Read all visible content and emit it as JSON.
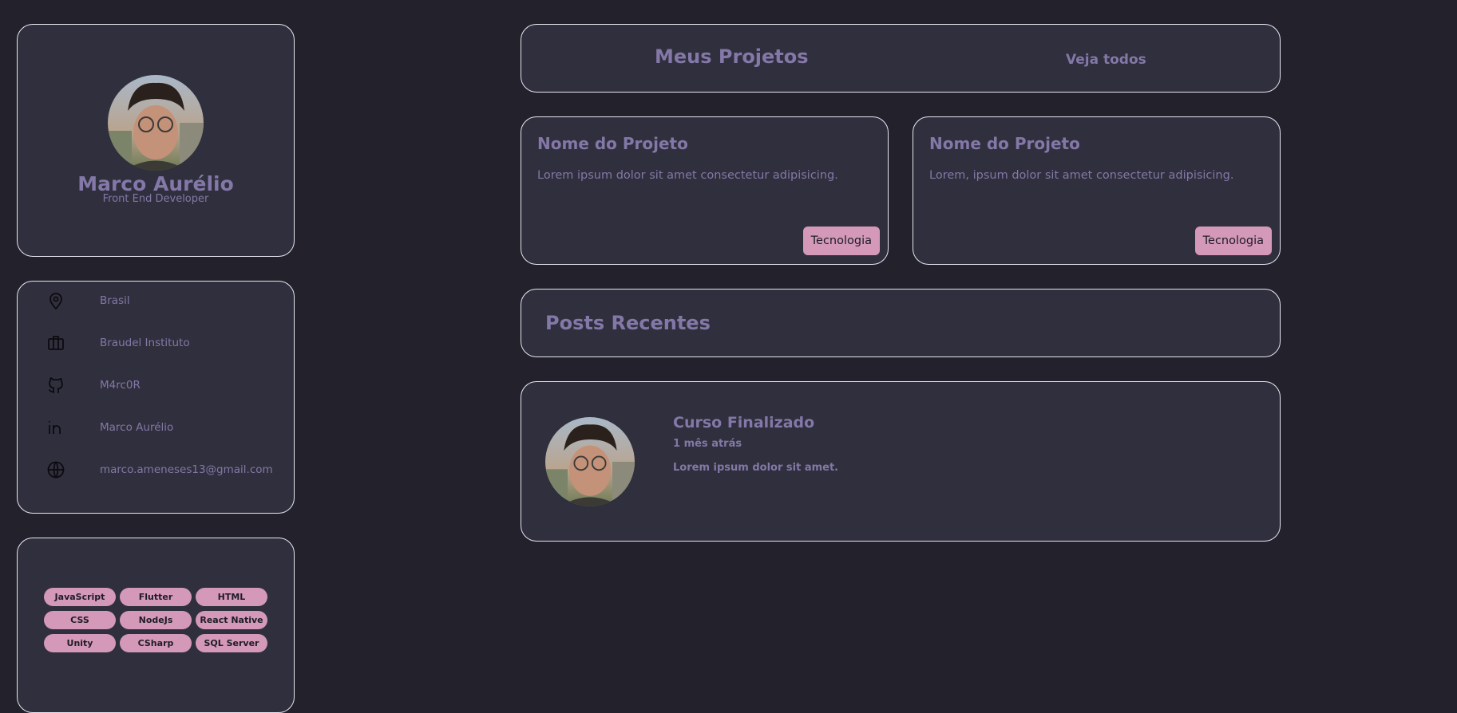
{
  "profile": {
    "name": "Marco Aurélio",
    "role": "Front End Developer"
  },
  "info": [
    {
      "icon": "location-pin-icon",
      "text": "Brasil"
    },
    {
      "icon": "briefcase-icon",
      "text": "Braudel Instituto"
    },
    {
      "icon": "github-icon",
      "text": "M4rc0R"
    },
    {
      "icon": "linkedin-icon",
      "text": "Marco Aurélio"
    },
    {
      "icon": "globe-icon",
      "text": "marco.ameneses13@gmail.com"
    }
  ],
  "skills": [
    "JavaScript",
    "Flutter",
    "HTML",
    "CSS",
    "NodeJs",
    "React Native",
    "Unity",
    "CSharp",
    "SQL Server"
  ],
  "projects": {
    "title": "Meus Projetos",
    "see_all": "Veja todos",
    "items": [
      {
        "name": "Nome do Projeto",
        "description": "Lorem ipsum dolor sit amet consectetur adipisicing.",
        "tag": "Tecnologia"
      },
      {
        "name": "Nome do Projeto",
        "description": "Lorem, ipsum dolor sit amet consectetur adipisicing.",
        "tag": "Tecnologia"
      }
    ]
  },
  "posts": {
    "title": "Posts Recentes",
    "items": [
      {
        "title": "Curso Finalizado",
        "time": "1 mês atrás",
        "text": "Lorem ipsum dolor sit amet."
      }
    ]
  },
  "colors": {
    "background": "#22212c",
    "card": "#302f3d",
    "accent_text": "#8378a7",
    "badge": "#d499b9"
  }
}
